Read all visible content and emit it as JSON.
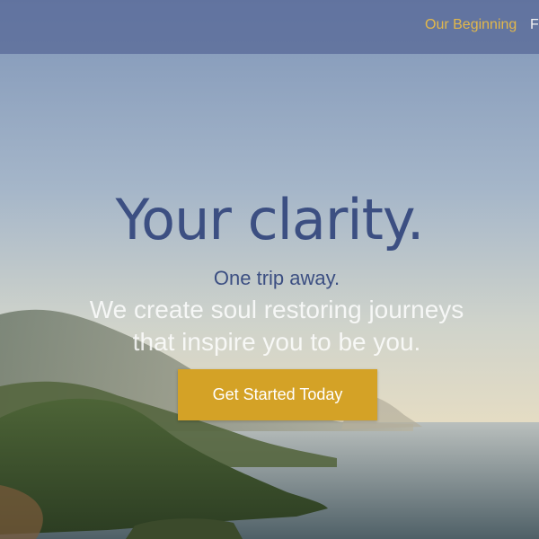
{
  "nav": {
    "items": [
      {
        "label": "Our Beginning"
      },
      {
        "label": "F"
      }
    ]
  },
  "hero": {
    "headline": "Your clarity.",
    "subheadline": "One trip away.",
    "tagline_line1": "We create soul restoring journeys",
    "tagline_line2": "that inspire you to be you.",
    "cta_label": "Get Started Today"
  },
  "colors": {
    "nav_link": "#e3b84a",
    "headline": "#3c4f82",
    "cta_background": "#d4a226",
    "navbar": "#566796"
  }
}
